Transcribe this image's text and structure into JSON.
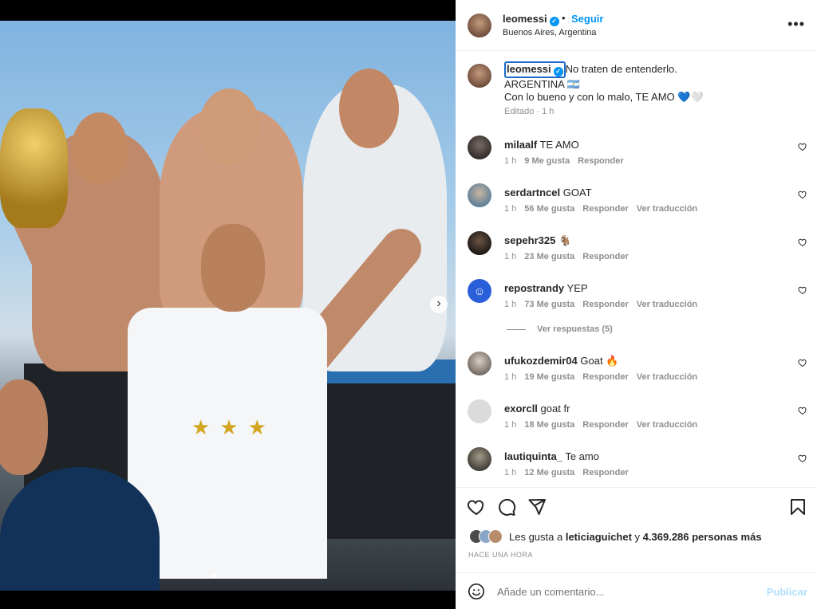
{
  "post": {
    "username": "leomessi",
    "separator": "•",
    "follow_label": "Seguir",
    "location": "Buenos Aires, Argentina",
    "more_icon": "more-icon"
  },
  "caption": {
    "username": "leomessi",
    "line1": "No traten de entenderlo.",
    "line2": "ARGENTINA 🇦🇷",
    "line3": "Con lo bueno y con lo malo, TE AMO 💙🤍",
    "edited": "Editado · 1 h"
  },
  "comments": [
    {
      "user": "milaalf",
      "text": "TE AMO",
      "time": "1 h",
      "likes": "9 Me gusta",
      "reply": "Responder",
      "translate": ""
    },
    {
      "user": "serdartncel",
      "text": "GOAT",
      "time": "1 h",
      "likes": "56 Me gusta",
      "reply": "Responder",
      "translate": "Ver traducción"
    },
    {
      "user": "sepehr325",
      "text": "🐐",
      "time": "1 h",
      "likes": "23 Me gusta",
      "reply": "Responder",
      "translate": ""
    },
    {
      "user": "repostrandy",
      "text": "YEP",
      "time": "1 h",
      "likes": "73 Me gusta",
      "reply": "Responder",
      "translate": "Ver traducción"
    },
    {
      "user": "ufukozdemir04",
      "text": "Goat 🔥",
      "time": "1 h",
      "likes": "19 Me gusta",
      "reply": "Responder",
      "translate": "Ver traducción"
    },
    {
      "user": "exorcll",
      "text": "goat fr",
      "time": "1 h",
      "likes": "18 Me gusta",
      "reply": "Responder",
      "translate": "Ver traducción"
    },
    {
      "user": "lautiquinta_",
      "text": "Te amo",
      "time": "1 h",
      "likes": "12 Me gusta",
      "reply": "Responder",
      "translate": ""
    }
  ],
  "view_replies": "Ver respuestas (5)",
  "likes": {
    "prefix": "Les gusta a",
    "user": "leticiaguichet",
    "middle": "y",
    "count": "4.369.286 personas más"
  },
  "time_ago": "HACE UNA HORA",
  "add_comment": {
    "placeholder": "Añade un comentario...",
    "publish_label": "Publicar"
  },
  "carousel": {
    "slides": 4,
    "active": 0
  },
  "colors": {
    "accent": "#0095f6",
    "muted": "#8e8e8e",
    "publish_disabled": "#b2dffc"
  }
}
